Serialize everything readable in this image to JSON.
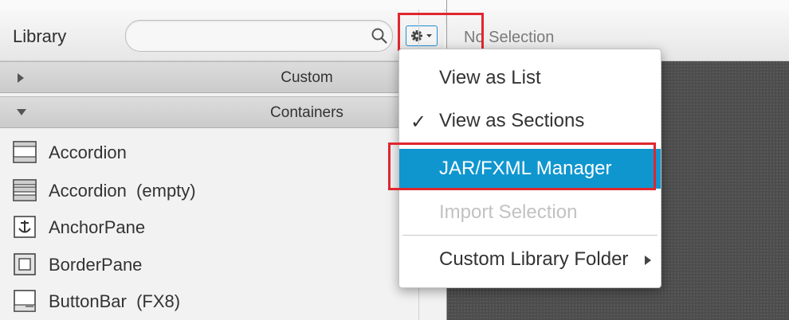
{
  "library": {
    "title": "Library",
    "search": {
      "value": "",
      "placeholder": ""
    },
    "sections": [
      {
        "label": "Custom",
        "expanded": false
      },
      {
        "label": "Containers",
        "expanded": true
      }
    ],
    "items": [
      {
        "label": "Accordion",
        "icon": "accordion-icon"
      },
      {
        "label": "Accordion  (empty)",
        "icon": "accordion-empty-icon"
      },
      {
        "label": "AnchorPane",
        "icon": "anchor-pane-icon"
      },
      {
        "label": "BorderPane",
        "icon": "border-pane-icon"
      },
      {
        "label": "ButtonBar  (FX8)",
        "icon": "button-bar-icon"
      }
    ]
  },
  "hierarchy": {
    "no_selection": "No Selection"
  },
  "menu": {
    "items": [
      {
        "label": "View as List",
        "checked": false,
        "enabled": true
      },
      {
        "label": "View as Sections",
        "checked": true,
        "check_glyph": "✓",
        "enabled": true
      },
      {
        "label": "JAR/FXML Manager",
        "highlighted": true,
        "enabled": true
      },
      {
        "label": "Import Selection",
        "enabled": false
      },
      {
        "label": "Custom Library Folder",
        "submenu": true,
        "enabled": true
      }
    ]
  },
  "colors": {
    "highlight": "#0f96cf",
    "annotation": "#e0262e",
    "canvas": "#4d4d4d"
  }
}
